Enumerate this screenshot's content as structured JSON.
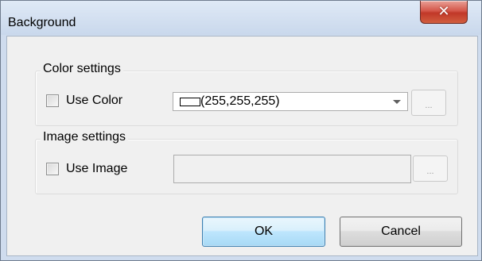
{
  "window": {
    "title": "Background",
    "close_icon": "close-icon"
  },
  "color_settings": {
    "group_label": "Color settings",
    "use_color_label": "Use Color",
    "use_color_checked": false,
    "color_value": "(255,255,255)",
    "swatch_color": "#ffffff",
    "browse_label": "..."
  },
  "image_settings": {
    "group_label": "Image settings",
    "use_image_label": "Use Image",
    "use_image_checked": false,
    "image_path": "",
    "browse_label": "..."
  },
  "buttons": {
    "ok_label": "OK",
    "cancel_label": "Cancel"
  },
  "colors": {
    "accent": "#3c7fb1",
    "close": "#c13828"
  }
}
